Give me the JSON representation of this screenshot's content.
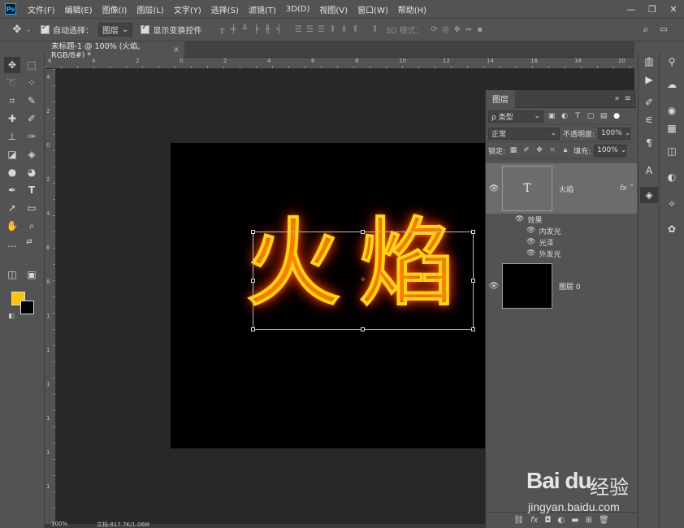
{
  "app": {
    "logo": "Ps"
  },
  "menu": [
    "文件(F)",
    "编辑(E)",
    "图像(I)",
    "图层(L)",
    "文字(Y)",
    "选择(S)",
    "滤镜(T)",
    "3D(D)",
    "视图(V)",
    "窗口(W)",
    "帮助(H)"
  ],
  "window_controls": {
    "minimize": "—",
    "restore": "❐",
    "close": "✕"
  },
  "options": {
    "auto_select_label": "自动选择：",
    "auto_select_value": "图层",
    "show_transform_label": "显示变换控件",
    "mode_3d_label": "3D 模式："
  },
  "document": {
    "tab_title": "未标题-1 @ 100% (火焰, RGB/8#) *",
    "text_content": "火焰"
  },
  "ruler_top_labels": [
    "6",
    "4",
    "2",
    "0",
    "2",
    "4",
    "6",
    "8",
    "10",
    "12",
    "14",
    "16",
    "18",
    "20"
  ],
  "ruler_left_labels": [
    "4",
    "2",
    "0",
    "2",
    "4",
    "6",
    "8",
    "1",
    "1",
    "1",
    "1",
    "1",
    "1"
  ],
  "colors": {
    "foreground": "#ffc10a",
    "background": "#000000",
    "glow_stroke": "#ffd21a",
    "glow_outer": "#ff4b00"
  },
  "layers_panel": {
    "tab_label": "图层",
    "filter_label": "ρ 类型",
    "blend_mode": "正常",
    "opacity_label": "不透明度:",
    "opacity_value": "100%",
    "lock_label": "锁定:",
    "fill_label": "填充:",
    "fill_value": "100%",
    "layers": [
      {
        "name": "火焰",
        "type": "text",
        "thumb_letter": "T",
        "fx": "fx"
      },
      {
        "name": "图层 0",
        "type": "pixel"
      }
    ],
    "effects_label": "效果",
    "effects": [
      "内发光",
      "光泽",
      "外发光"
    ]
  },
  "status": {
    "zoom": "100%",
    "doc_info": "文档:817.7K/1.06M"
  },
  "watermark": {
    "brand": "Bai du",
    "sub": "经验",
    "url": "jingyan.baidu.com"
  }
}
